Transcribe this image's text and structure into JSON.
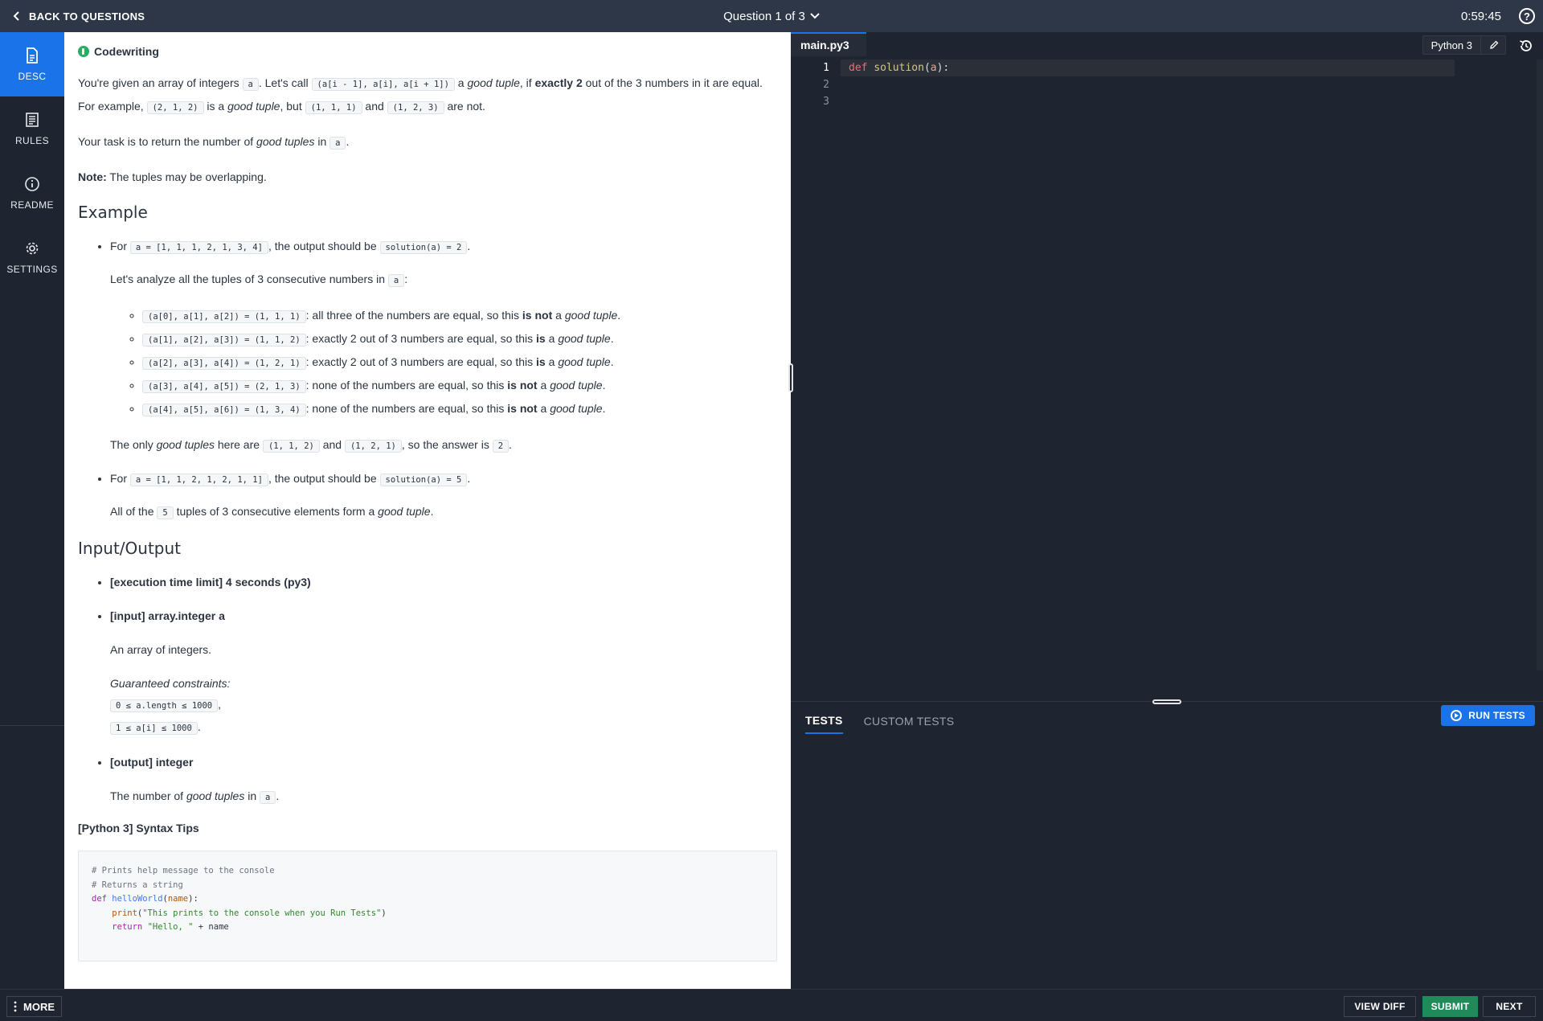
{
  "topbar": {
    "back_label": "BACK TO QUESTIONS",
    "question_label": "Question 1 of 3",
    "timer": "0:59:45",
    "help_label": "?"
  },
  "nav": [
    {
      "label": "DESC",
      "icon": "document-icon",
      "active": true
    },
    {
      "label": "RULES",
      "icon": "list-icon",
      "active": false
    },
    {
      "label": "README",
      "icon": "info-icon",
      "active": false
    },
    {
      "label": "SETTINGS",
      "icon": "gear-icon",
      "active": false
    }
  ],
  "desc": {
    "tag": "Codewriting",
    "p1": {
      "t1": "You're given an array of integers ",
      "c1": "a",
      "t2": ". Let's call ",
      "c2": "(a[i - 1], a[i], a[i + 1])",
      "t3": " a ",
      "em1": "good tuple",
      "t4": ", if ",
      "b1": "exactly 2",
      "t5": " out of the 3 numbers in it are equal. For example, ",
      "c3": "(2, 1, 2)",
      "t6": " is a ",
      "em2": "good tuple",
      "t7": ", but ",
      "c4": "(1, 1, 1)",
      "t8": " and ",
      "c5": "(1, 2, 3)",
      "t9": " are not."
    },
    "p2": {
      "t1": "Your task is to return the number of ",
      "em": "good tuples",
      "t2": " in ",
      "c": "a",
      "t3": "."
    },
    "p3": {
      "b": "Note:",
      "t": " The tuples may be overlapping."
    },
    "example_heading": "Example",
    "ex1": {
      "t1": "For ",
      "c1": "a = [1, 1, 1, 2, 1, 3, 4]",
      "t2": ", the output should be ",
      "c2": "solution(a) = 2",
      "t3": ".",
      "analyze": {
        "t1": "Let's analyze all the tuples of 3 consecutive numbers in ",
        "c": "a",
        "t2": ":"
      },
      "items": [
        {
          "code": "(a[0], a[1], a[2]) = (1, 1, 1)",
          "t1": ": all three of the numbers are equal, so this ",
          "b": "is not",
          "t2": " a ",
          "em": "good tuple",
          "t3": "."
        },
        {
          "code": "(a[1], a[2], a[3]) = (1, 1, 2)",
          "t1": ": exactly 2 out of 3 numbers are equal, so this ",
          "b": "is",
          "t2": " a ",
          "em": "good tuple",
          "t3": "."
        },
        {
          "code": "(a[2], a[3], a[4]) = (1, 2, 1)",
          "t1": ": exactly 2 out of 3 numbers are equal, so this ",
          "b": "is",
          "t2": " a ",
          "em": "good tuple",
          "t3": "."
        },
        {
          "code": "(a[3], a[4], a[5]) = (2, 1, 3)",
          "t1": ": none of the numbers are equal, so this ",
          "b": "is not",
          "t2": " a ",
          "em": "good tuple",
          "t3": "."
        },
        {
          "code": "(a[4], a[5], a[6]) = (1, 3, 4)",
          "t1": ": none of the numbers are equal, so this ",
          "b": "is not",
          "t2": " a ",
          "em": "good tuple",
          "t3": "."
        }
      ],
      "only": {
        "t1": "The only ",
        "em": "good tuples",
        "t2": " here are ",
        "c1": "(1, 1, 2)",
        "t3": " and ",
        "c2": "(1, 2, 1)",
        "t4": ", so the answer is ",
        "c3": "2",
        "t5": "."
      }
    },
    "ex2": {
      "t1": "For ",
      "c1": "a = [1, 1, 2, 1, 2, 1, 1]",
      "t2": ", the output should be ",
      "c2": "solution(a) = 5",
      "t3": ".",
      "all": {
        "t1": "All of the ",
        "c": "5",
        "t2": " tuples of 3 consecutive elements form a ",
        "em": "good tuple",
        "t3": "."
      }
    },
    "io_heading": "Input/Output",
    "io": {
      "time_limit": "[execution time limit] 4 seconds (py3)",
      "input_title": "[input] array.integer a",
      "input_desc": "An array of integers.",
      "constraints_label": "Guaranteed constraints:",
      "c1": "0 ≤ a.length ≤ 1000",
      "c1_sep": ",",
      "c2": "1 ≤ a[i] ≤ 1000",
      "c2_sep": ".",
      "output_title": "[output] integer",
      "output_t1": "The number of ",
      "output_em": "good tuples",
      "output_t2": " in ",
      "output_c": "a",
      "output_t3": "."
    },
    "syntax_title": "[Python 3] Syntax Tips",
    "syntax": {
      "l1": "# Prints help message to the console",
      "l2": "# Returns a string",
      "l3_kw": "def",
      "l3_fn": "helloWorld",
      "l3_p1": "(",
      "l3_arg": "name",
      "l3_p2": "):",
      "l4_fn": "print",
      "l4_p1": "(",
      "l4_str": "\"This prints to the console when you Run Tests\"",
      "l4_p2": ")",
      "l5_kw": "return",
      "l5_str": "\"Hello, \"",
      "l5_rest": " + name"
    }
  },
  "editor": {
    "tab": "main.py3",
    "language": "Python 3",
    "line_numbers": [
      "1",
      "2",
      "3"
    ],
    "code": {
      "kw": "def",
      "fn": "solution",
      "p1": "(",
      "param": "a",
      "p2": "):"
    }
  },
  "tests": {
    "tab_tests": "TESTS",
    "tab_custom": "CUSTOM TESTS",
    "run_label": "RUN TESTS"
  },
  "bottom": {
    "more_label": "MORE",
    "view_diff": "VIEW DIFF",
    "submit": "SUBMIT",
    "next": "NEXT"
  }
}
